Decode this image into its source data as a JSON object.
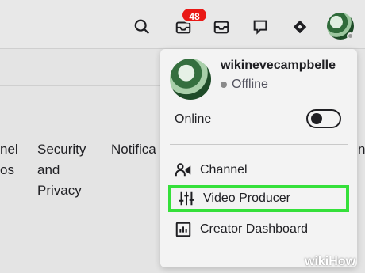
{
  "topbar": {
    "notification_count": "48",
    "icons": [
      "search-icon",
      "notifications-icon",
      "inbox-icon",
      "whispers-icon",
      "prime-loot-icon"
    ]
  },
  "settings_tabs": [
    {
      "label": "nel\nos"
    },
    {
      "label": "Security\nand\nPrivacy"
    },
    {
      "label": "Notifica"
    },
    {
      "label": "nn"
    }
  ],
  "dropdown": {
    "username": "wikinevecampbelle",
    "status": "Offline",
    "online_label": "Online",
    "online_toggle": false,
    "items": [
      {
        "label": "Channel",
        "icon": "channel-icon"
      },
      {
        "label": "Video Producer",
        "icon": "video-producer-icon",
        "highlighted": true
      },
      {
        "label": "Creator Dashboard",
        "icon": "creator-dashboard-icon"
      }
    ]
  },
  "watermark": "wikiHow",
  "colors": {
    "badge": "#e91916",
    "highlight": "#35e03a",
    "text": "#1f1f23"
  }
}
